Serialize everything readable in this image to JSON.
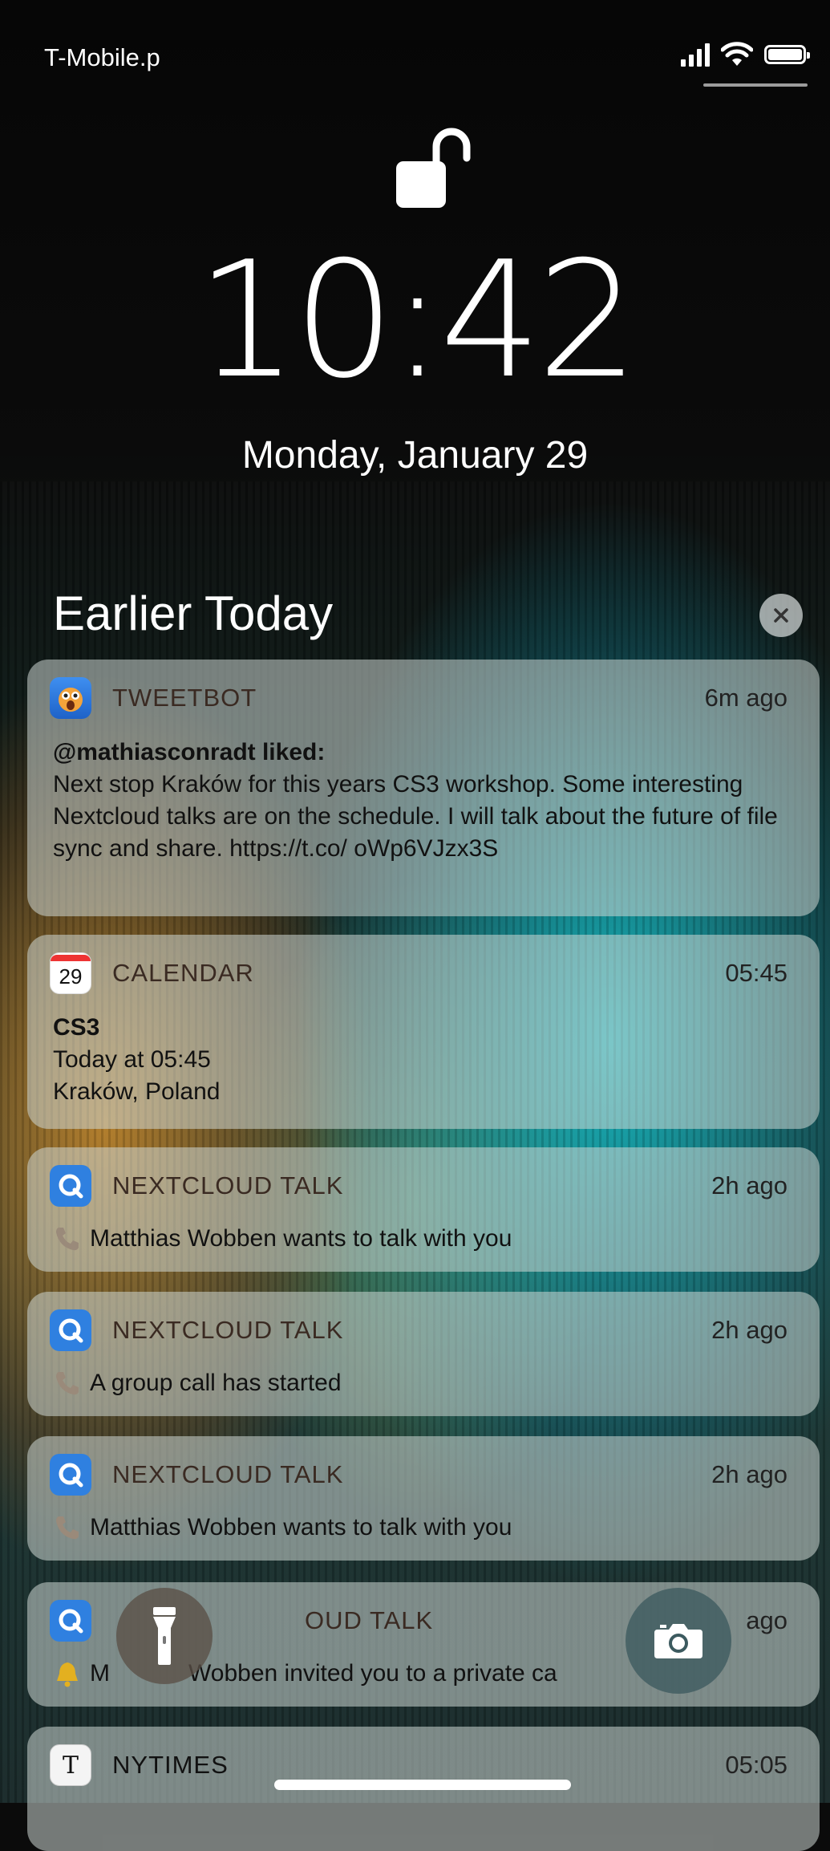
{
  "status_bar": {
    "carrier": "T-Mobile.p"
  },
  "lock_screen": {
    "time": "10:42",
    "date": "Monday, January 29"
  },
  "notifications": {
    "section_title": "Earlier Today",
    "items": [
      {
        "app": "TWEETBOT",
        "time": "6m ago",
        "title": "@mathiasconradt liked:",
        "body": "Next stop Kraków for this years CS3 workshop. Some interesting Nextcloud talks are on the schedule. I will talk about the future of file sync and share. https://t.co/ oWp6VJzx3S"
      },
      {
        "app": "CALENDAR",
        "time": "05:45",
        "calendar_day": "29",
        "title": "CS3",
        "line1": "Today at 05:45",
        "line2": "Kraków, Poland"
      },
      {
        "app": "NEXTCLOUD TALK",
        "time": "2h ago",
        "body": "Matthias Wobben wants to talk with you"
      },
      {
        "app": "NEXTCLOUD TALK",
        "time": "2h ago",
        "body": "A group call has started"
      },
      {
        "app": "NEXTCLOUD TALK",
        "time": "2h ago",
        "body": "Matthias Wobben wants to talk with you"
      },
      {
        "app_visible_fragment": "OUD TALK",
        "time_visible_fragment": "ago",
        "body_prefix": "M",
        "body_middle": "Wobben invited you to a private ca"
      },
      {
        "app": "NYTIMES",
        "time": "05:05",
        "app_icon_glyph": "T"
      }
    ]
  },
  "icons": {
    "lock": "unlocked-padlock-icon",
    "clear": "close-icon",
    "flashlight": "flashlight-icon",
    "camera": "camera-icon",
    "call": "phone-icon",
    "bell": "bell-icon"
  }
}
